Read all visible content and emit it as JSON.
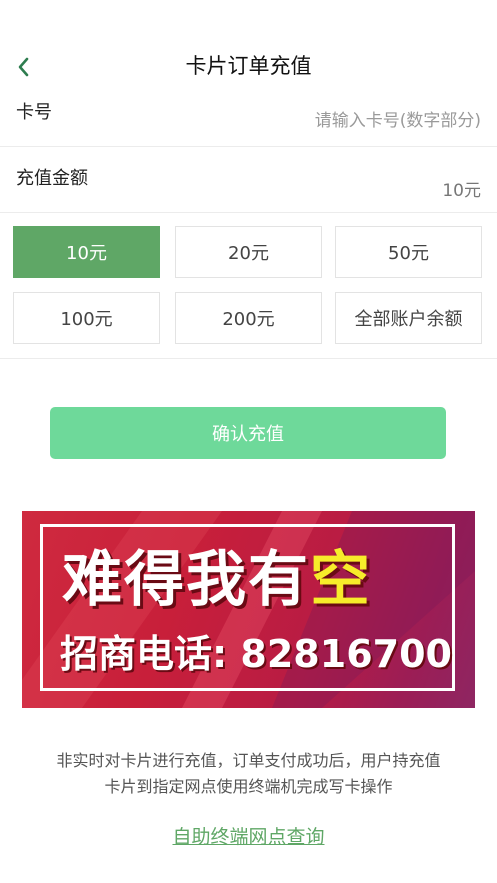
{
  "header": {
    "back_icon": "chevron-left-icon",
    "title": "卡片订单充值"
  },
  "card_number": {
    "label": "卡号",
    "placeholder": "请输入卡号(数字部分)"
  },
  "amount": {
    "label": "充值金额",
    "value": "10元"
  },
  "amount_options": [
    "10元",
    "20元",
    "50元",
    "100元",
    "200元",
    "全部账户余额"
  ],
  "selected_option": "10元",
  "confirm_label": "确认充值",
  "banner": {
    "line1_white": "难得我有",
    "line1_yellow": "空",
    "line2": "招商电话: 82816700"
  },
  "notice": {
    "line1": "非实时对卡片进行充值，订单支付成功后，用户持充值",
    "line2": "卡片到指定网点使用终端机完成写卡操作"
  },
  "link_label": "自助终端网点查询",
  "colors": {
    "accent_green": "#5fa766",
    "button_green": "#6ed99a",
    "banner_red": "#c81f3a",
    "banner_yellow": "#f7ec2a"
  }
}
